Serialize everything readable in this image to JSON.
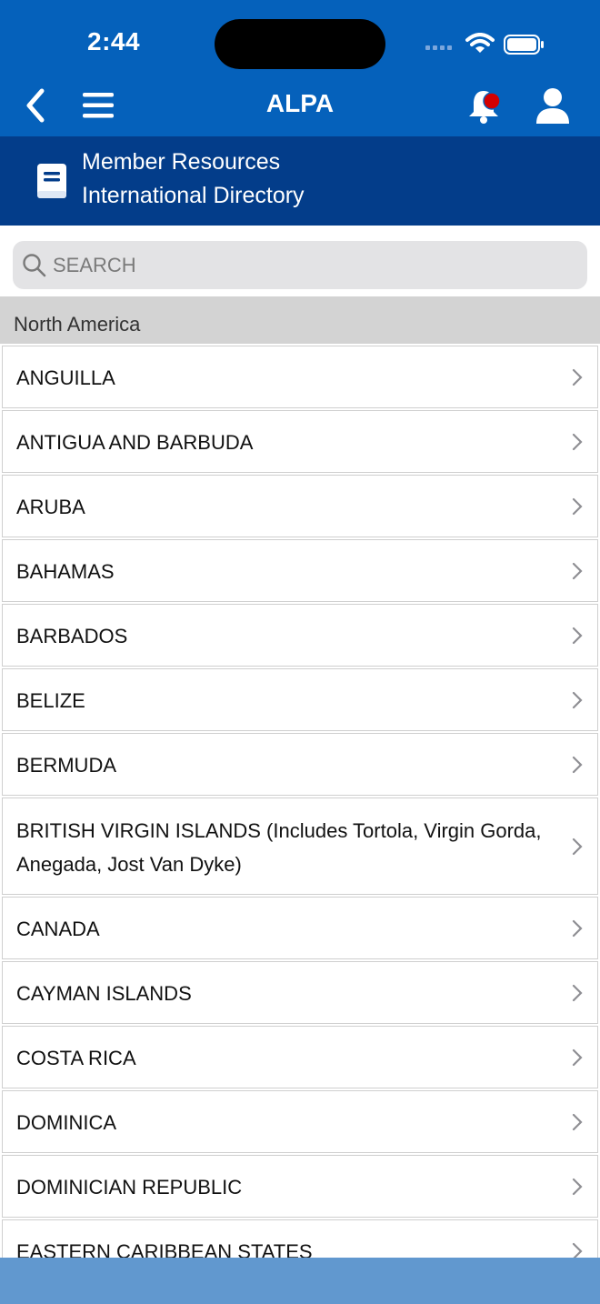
{
  "status_bar": {
    "time": "2:44"
  },
  "nav": {
    "title": "ALPA"
  },
  "subheader": {
    "line1": "Member Resources",
    "line2": "International Directory"
  },
  "search": {
    "placeholder": "SEARCH",
    "value": ""
  },
  "section": {
    "label": "North America"
  },
  "countries": [
    {
      "label": "ANGUILLA"
    },
    {
      "label": "ANTIGUA AND BARBUDA"
    },
    {
      "label": "ARUBA"
    },
    {
      "label": "BAHAMAS"
    },
    {
      "label": "BARBADOS"
    },
    {
      "label": "BELIZE"
    },
    {
      "label": "BERMUDA"
    },
    {
      "label": "BRITISH VIRGIN ISLANDS  (Includes Tortola, Virgin Gorda, Anegada, Jost Van Dyke)"
    },
    {
      "label": "CANADA"
    },
    {
      "label": "CAYMAN ISLANDS"
    },
    {
      "label": "COSTA RICA"
    },
    {
      "label": "DOMINICA"
    },
    {
      "label": "DOMINICIAN REPUBLIC"
    },
    {
      "label": "EASTERN CARIBBEAN STATES"
    }
  ],
  "colors": {
    "nav_blue": "#0561bb",
    "subheader_blue": "#033d8a",
    "notification_dot": "#d40000",
    "bottom_bar": "#6198cf"
  },
  "icons": {
    "back": "chevron-left-icon",
    "menu": "hamburger-menu-icon",
    "bell": "bell-icon",
    "user": "user-icon",
    "book": "book-icon",
    "search": "search-icon",
    "row": "chevron-right-icon"
  }
}
